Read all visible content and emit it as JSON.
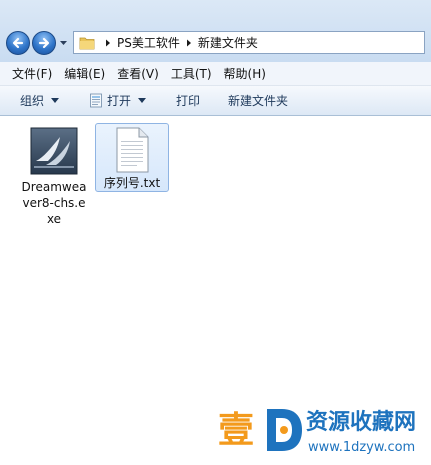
{
  "address": {
    "crumbs": [
      "PS美工软件",
      "新建文件夹"
    ]
  },
  "menu": {
    "items": [
      "文件(F)",
      "编辑(E)",
      "查看(V)",
      "工具(T)",
      "帮助(H)"
    ]
  },
  "commands": {
    "organize": "组织",
    "open": "打开",
    "print": "打印",
    "new_folder": "新建文件夹"
  },
  "files": [
    {
      "name": "Dreamweaver8-chs.exe",
      "icon": "dreamweaver-exe-icon",
      "selected": false
    },
    {
      "name": "序列号.txt",
      "icon": "text-file-icon",
      "selected": true
    }
  ],
  "watermark": {
    "char": "壹",
    "name": "资源收藏网",
    "url": "www.1dzyw.com"
  },
  "colors": {
    "selection": "#d6e7fb",
    "watermark_orange": "#f39a1c",
    "watermark_blue": "#1e73be"
  }
}
